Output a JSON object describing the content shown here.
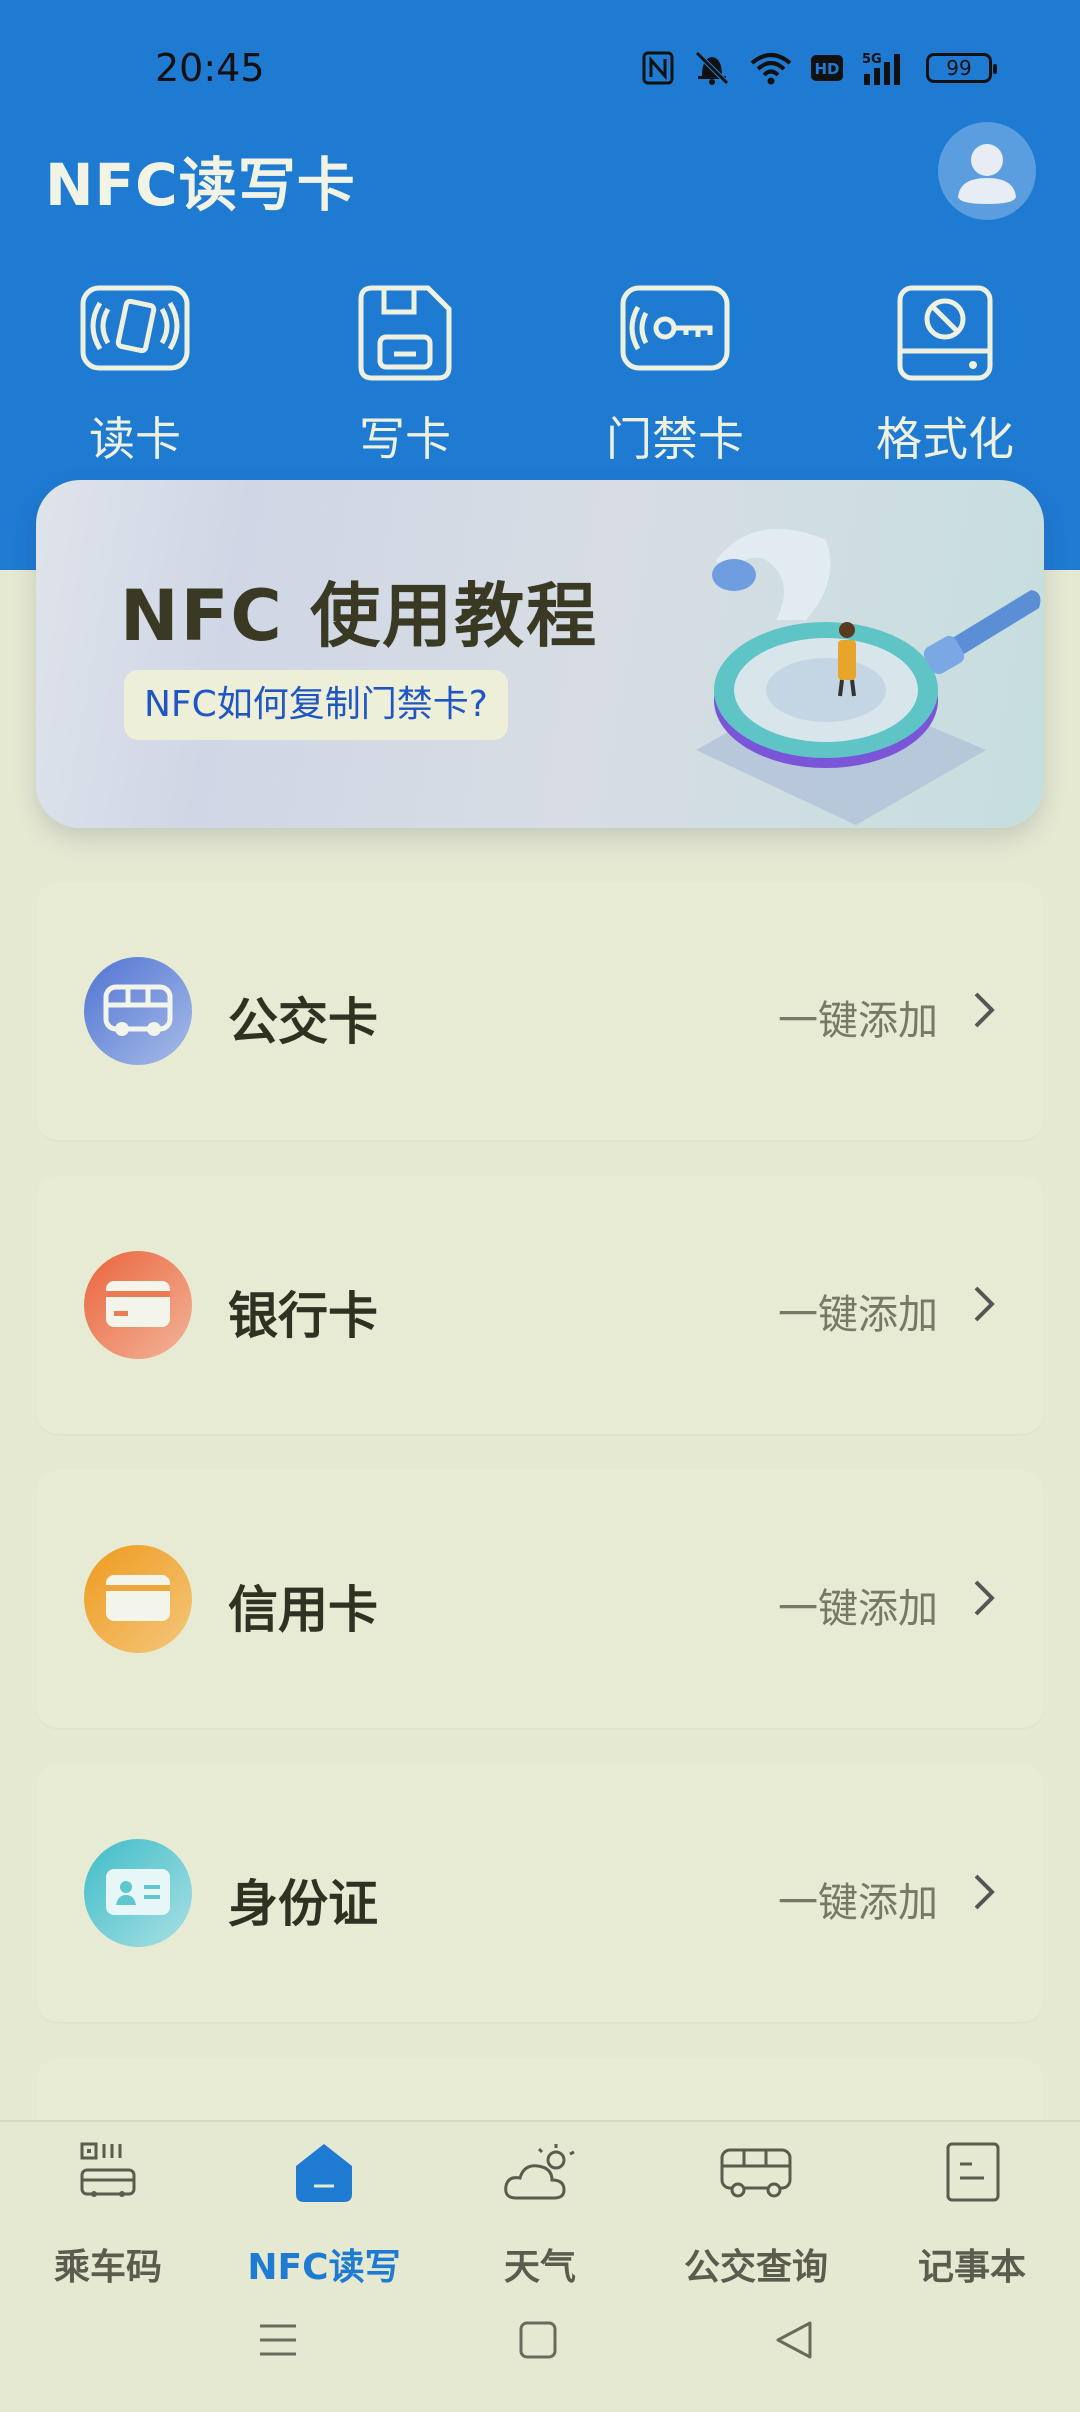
{
  "status_bar": {
    "time": "20:45",
    "battery": "99"
  },
  "app": {
    "title": "NFC读写卡"
  },
  "quick_actions": [
    {
      "label": "读卡",
      "icon": "nfc-card-read-icon"
    },
    {
      "label": "写卡",
      "icon": "floppy-save-icon"
    },
    {
      "label": "门禁卡",
      "icon": "access-key-icon"
    },
    {
      "label": "格式化",
      "icon": "format-drive-icon"
    }
  ],
  "banner": {
    "title": "NFC 使用教程",
    "subtitle": "NFC如何复制门禁卡?"
  },
  "cards": [
    {
      "title": "公交卡",
      "action": "一键添加",
      "icon": "bus-icon",
      "color": "#5b82d6"
    },
    {
      "title": "银行卡",
      "action": "一键添加",
      "icon": "bank-card-icon",
      "color": "#ec7a55"
    },
    {
      "title": "信用卡",
      "action": "一键添加",
      "icon": "credit-card-icon",
      "color": "#eea53a"
    },
    {
      "title": "身份证",
      "action": "一键添加",
      "icon": "id-card-icon",
      "color": "#5ec7cf"
    }
  ],
  "bottom_nav": [
    {
      "label": "乘车码",
      "icon": "qr-bus-icon",
      "active": false
    },
    {
      "label": "NFC读写",
      "icon": "home-icon",
      "active": true
    },
    {
      "label": "天气",
      "icon": "weather-cloud-icon",
      "active": false
    },
    {
      "label": "公交查询",
      "icon": "bus-query-icon",
      "active": false
    },
    {
      "label": "记事本",
      "icon": "notebook-icon",
      "active": false
    }
  ],
  "colors": {
    "header": "#1f7ad2",
    "background": "#e6e9d2",
    "card": "#e8ebd3",
    "active_nav": "#1f7ad2"
  }
}
